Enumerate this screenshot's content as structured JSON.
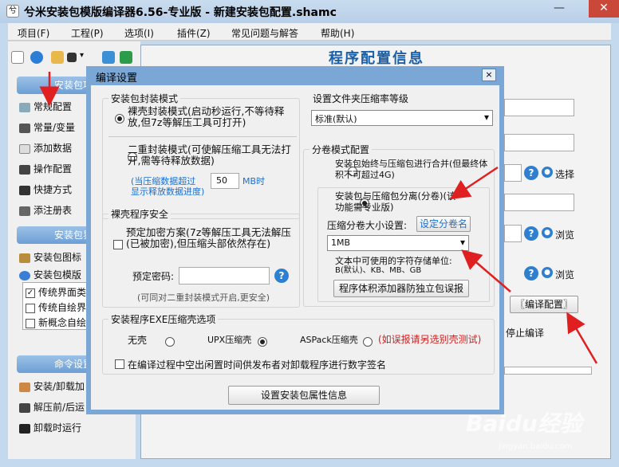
{
  "window": {
    "title": "兮米安装包模版编译器6.56-专业版 - 新建安装包配置.shamc"
  },
  "menu": [
    "项目(F)",
    "工程(P)",
    "选项(I)",
    "插件(Z)",
    "常见问题与解答",
    "帮助(H)"
  ],
  "right_panel": {
    "title": "程序配置信息",
    "select_label": "选择",
    "browse_label_1": "浏览",
    "browse_label_2": "浏览",
    "compile_button": "〖编译配置〗",
    "stop_label": "停止编译"
  },
  "sidebar": {
    "header1": "安装包项",
    "items1": [
      "常规配置",
      "常量/变量",
      "添加数据",
      "操作配置",
      "快捷方式",
      "添注册表"
    ],
    "header2": "安装包界",
    "items2": [
      "安装包图标",
      "安装包模版"
    ],
    "checks": [
      {
        "label": "传统界面类",
        "checked": true
      },
      {
        "label": "传统自绘界",
        "checked": false
      },
      {
        "label": "新概念自绘",
        "checked": false
      }
    ],
    "header3": "命令设置",
    "items3": [
      "安装/卸载加",
      "解压前/后运",
      "卸载时运行"
    ]
  },
  "dialog": {
    "title": "编译设置",
    "close": "×",
    "pack_mode": {
      "label": "安装包封装模式",
      "opt1": "裸壳封装模式(启动秒运行,不等待释放,但7z等解压工具可打开)",
      "opt2": "二重封装模式(可使解压缩工具无法打开,需等待释放数据)",
      "threshold_prefix": "(当压缩数据超过",
      "threshold_value": "50",
      "threshold_suffix": "MB时",
      "threshold_line2": "显示释放数据进度)"
    },
    "shell_security": {
      "label": "裸壳程序安全",
      "encrypt": "预定加密方案(7z等解压工具无法解压(已被加密),但压缩头部依然存在)",
      "password_label": "预定密码:",
      "password_value": "",
      "hint": "(可同对二重封装模式开启,更安全)"
    },
    "compress_level": {
      "label": "设置文件夹压缩率等级",
      "value": "标准(默认)"
    },
    "split": {
      "label": "分卷模式配置",
      "opt1": "安装包始终与压缩包进行合并(但最终体积不可超过4G)",
      "opt2": "安装包与压缩包分离(分卷)(该功能需专业版)",
      "size_label": "压缩分卷大小设置:",
      "size_link": "设定分卷名",
      "size_value": "1MB",
      "units_label": "文本中可使用的字符存储单位:",
      "units_value": "B(默认)、KB、MB、GB",
      "anti_split_button": "程序体积添加器防独立包误报"
    },
    "exe_shell": {
      "label": "安装程序EXE压缩壳选项",
      "options": [
        "无壳",
        "UPX压缩壳",
        "ASPack压缩壳"
      ],
      "selected": 1,
      "warning": "(如误报请另选别壳测试)",
      "sign": "在编译过程中空出闲置时间供发布者对卸载程序进行数字签名"
    },
    "bottom_button": "设置安装包属性信息"
  },
  "watermark": {
    "brand": "Baidu经验",
    "url": "jingyan.baidu.com"
  },
  "colors": {
    "accent": "#7aa7d6",
    "link": "#1a6fd0",
    "warning": "#d02020",
    "arrow": "#e02020"
  }
}
